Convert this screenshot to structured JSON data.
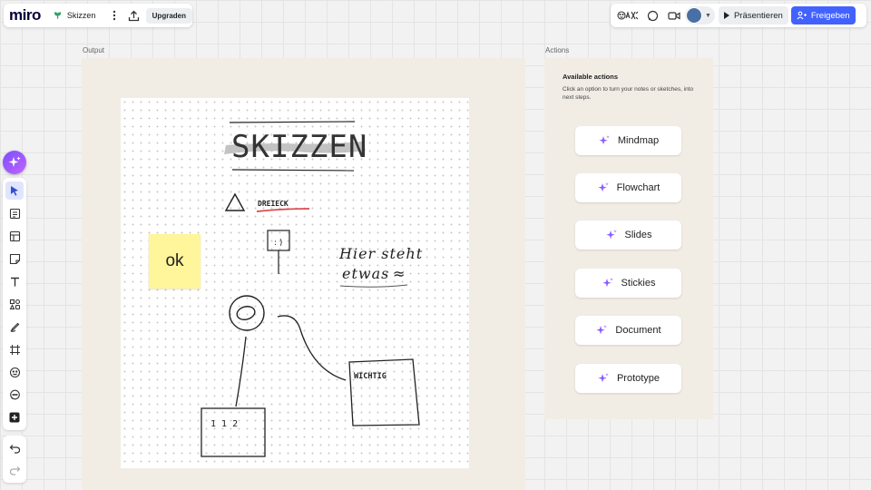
{
  "app": {
    "logo": "miro",
    "board_name": "Skizzen",
    "upgrade_label": "Upgraden",
    "brand_color": "#4262ff"
  },
  "header": {
    "present_label": "Präsentieren",
    "share_label": "Freigeben",
    "icons": [
      "reactions-icon",
      "comment-icon",
      "video-icon",
      "avatar",
      "play-icon",
      "share-users-icon"
    ]
  },
  "toolbar": {
    "tools": [
      "select-tool",
      "text-list-tool",
      "template-tool",
      "sticky-note-tool",
      "text-tool",
      "shapes-tool",
      "pen-tool",
      "frame-tool",
      "sticker-tool",
      "comment-tool",
      "more-tools"
    ],
    "history": [
      "undo-icon",
      "redo-icon"
    ]
  },
  "output": {
    "label": "Output",
    "sketch": {
      "title": "SKIZZEN",
      "triangle_label": "DREIECK",
      "note_line1": "Hier steht",
      "note_line2": "etwas",
      "tilde": "≈",
      "box_label": "WICHTIG",
      "small_box_label": "1 1 2",
      "sticky_text": "ok",
      "smiley": ": )"
    }
  },
  "actions": {
    "label": "Actions",
    "title": "Available actions",
    "description": "Click an option to turn your notes or sketches, into next steps.",
    "buttons": [
      {
        "label": "Mindmap"
      },
      {
        "label": "Flowchart"
      },
      {
        "label": "Slides"
      },
      {
        "label": "Stickies"
      },
      {
        "label": "Document"
      },
      {
        "label": "Prototype"
      }
    ],
    "spark_color": "#8a5cff"
  }
}
